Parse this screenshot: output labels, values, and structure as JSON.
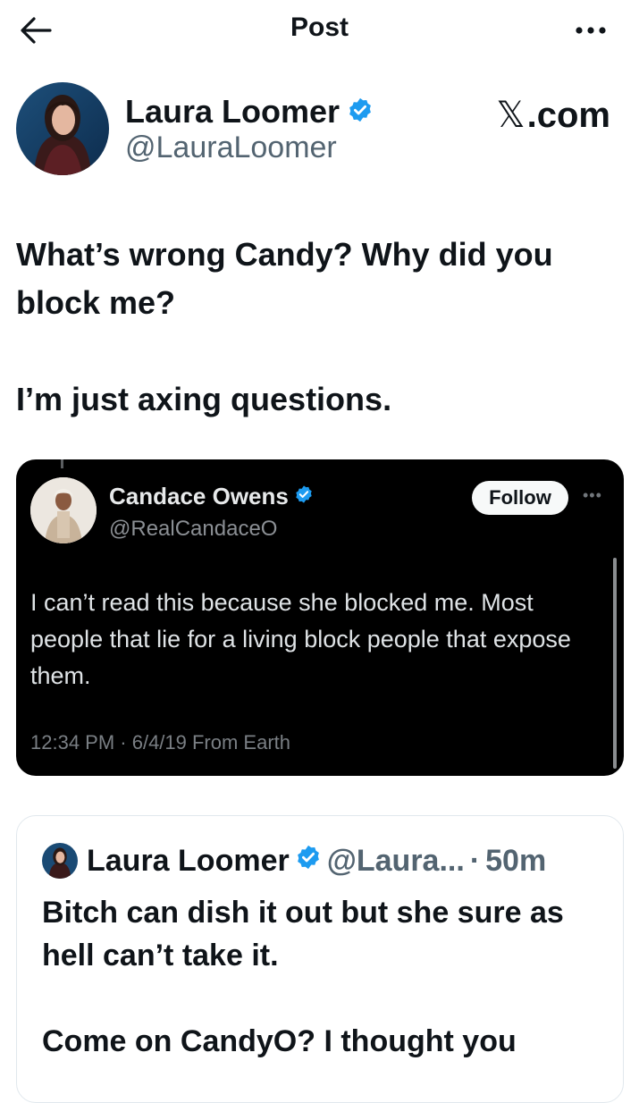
{
  "header": {
    "title": "Post",
    "back_icon": "back-arrow-icon",
    "more_icon": "more-horizontal-icon"
  },
  "author": {
    "name": "Laura Loomer",
    "handle": "@LauraLoomer",
    "verified": true,
    "site": ".com",
    "site_icon": "x-logo-icon"
  },
  "post": {
    "text": "What’s wrong Candy? Why did you block me?\n\nI’m just axing questions."
  },
  "embedded_tweet": {
    "name": "Candace Owens",
    "handle": "@RealCandaceO",
    "follow_label": "Follow",
    "text": "I can’t read this because she blocked me. Most people that lie for a living block people that expose them.",
    "timestamp": "12:34 PM · 6/4/19 From Earth",
    "verified": true
  },
  "quote_tweet": {
    "name": "Laura Loomer",
    "handle": "@Laura...",
    "separator": "·",
    "time": "50m",
    "verified": true,
    "text": "Bitch can dish it out but she sure as hell can’t take it.\n\nCome on CandyO? I thought you"
  },
  "colors": {
    "verified_blue": "#1d9bf0",
    "text": "#0f1419",
    "secondary": "#536471"
  }
}
